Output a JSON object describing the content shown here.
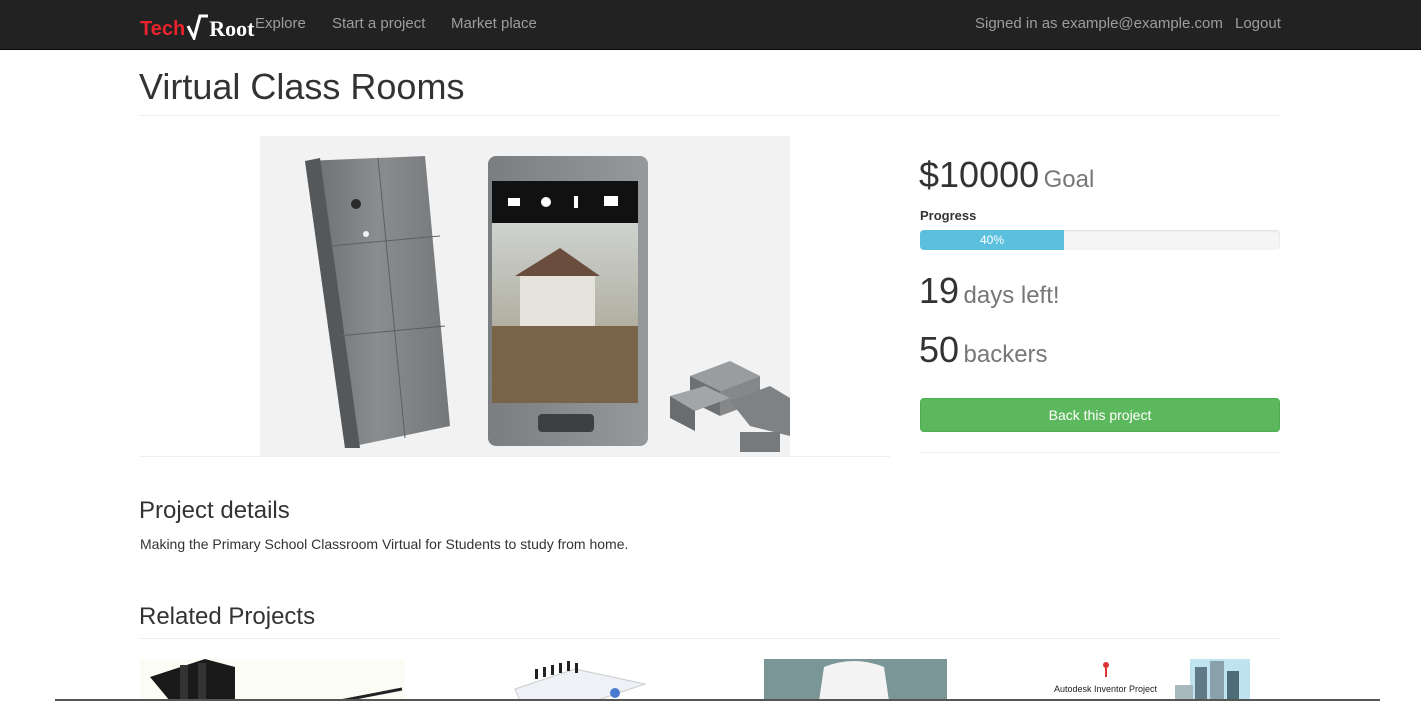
{
  "navbar": {
    "brand": {
      "part1": "Tech",
      "part2": "Root"
    },
    "links": [
      "Explore",
      "Start a project",
      "Market place"
    ],
    "signed_in": "Signed in as example@example.com",
    "logout": "Logout"
  },
  "project": {
    "title": "Virtual Class Rooms",
    "goal_amount": "$10000",
    "goal_label": "Goal",
    "progress_label": "Progress",
    "progress_percent": 40,
    "progress_text": "40%",
    "days_value": "19",
    "days_label": "days left!",
    "backers_value": "50",
    "backers_label": "backers",
    "back_button": "Back this project"
  },
  "details": {
    "heading": "Project details",
    "text": "Making the Primary School Classroom Virtual for Students to study from home."
  },
  "related": {
    "heading": "Related Projects",
    "items": [
      {
        "caption": ""
      },
      {
        "caption": ""
      },
      {
        "caption": ""
      },
      {
        "caption": "Autodesk Inventor Project"
      }
    ]
  },
  "colors": {
    "navbar_bg": "#222222",
    "brand_red": "#e8232b",
    "progress_bar": "#5bc0de",
    "button_green": "#5cb85c"
  }
}
